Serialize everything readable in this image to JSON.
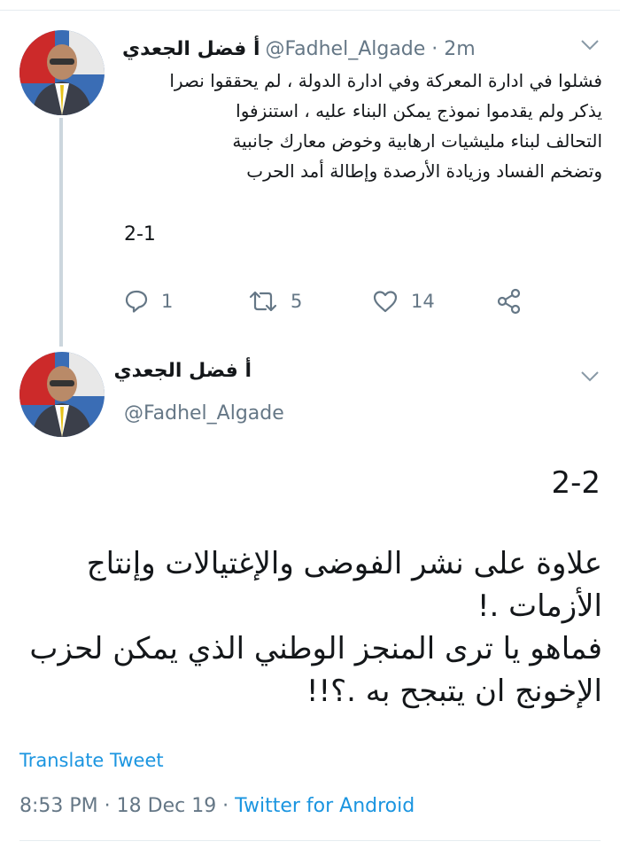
{
  "tweet1": {
    "author_name": "أ فضل الجعدي",
    "handle": "@Fadhel_Algade",
    "separator": " · ",
    "time": "2m",
    "text_lines": [
      "فشلوا في ادارة المعركة وفي ادارة الدولة ، لم يحققوا نصرا",
      "يذكر ولم يقدموا نموذج يمكن البناء عليه ، استنزفوا",
      "التحالف لبناء مليشيات ارهابية وخوض معارك جانبية",
      "وتضخم الفساد وزيادة الأرصدة وإطالة أمد الحرب"
    ],
    "thread_label": "2-1",
    "actions": {
      "replies": "1",
      "retweets": "5",
      "likes": "14"
    }
  },
  "tweet2": {
    "author_name": "أ فضل الجعدي",
    "handle": "@Fadhel_Algade",
    "thread_label": "2-2",
    "text_lines": [
      "علاوة على نشر الفوضى والإغتيالات وإنتاج",
      "الأزمات .!",
      "فماهو يا ترى المنجز الوطني الذي يمكن لحزب",
      "الإخونج ان يتبجح به .؟!!"
    ],
    "translate_label": "Translate Tweet",
    "time": "8:53 PM",
    "date": "18 Dec 19",
    "separator": " · ",
    "source": "Twitter for Android"
  },
  "icons": {
    "reply": "reply-icon",
    "retweet": "retweet-icon",
    "like": "heart-icon",
    "share": "share-icon",
    "more": "chevron-down-icon"
  },
  "colors": {
    "link": "#1b95e0",
    "secondary_text": "#657786",
    "thread_line": "#ccd6dd",
    "divider": "#e6ecf0"
  }
}
